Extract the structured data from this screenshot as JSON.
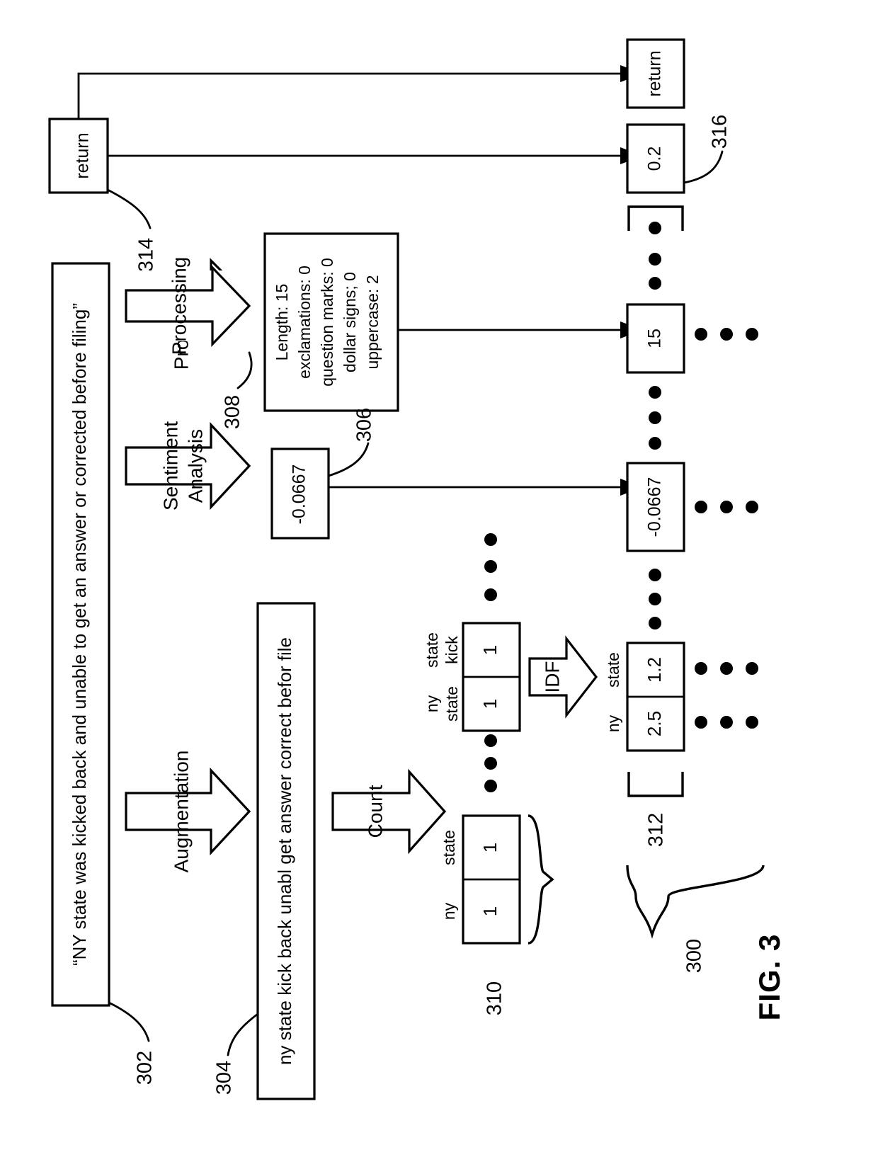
{
  "figure": {
    "label": "FIG. 3",
    "orientation": "landscape-rotated-90ccw"
  },
  "input": {
    "ref": "302",
    "text": "“NY state was kicked back and unable to get an answer or corrected before filing”"
  },
  "augmented": {
    "ref": "304",
    "text": "ny state kick back unabl get answer correct befor file"
  },
  "operations": {
    "processing": "Processing",
    "sentiment": "Sentiment\nAnalysis",
    "sentiment_line1": "Sentiment",
    "sentiment_line2": "Analysis",
    "augmentation": "Augmentation",
    "count": "Count",
    "idf": "IDF"
  },
  "processing_result": {
    "ref": "308",
    "lines": [
      "Length: 15",
      "exclamations: 0",
      "question marks: 0",
      "dollar signs; 0",
      "uppercase: 2"
    ]
  },
  "sentiment_result": {
    "ref": "306",
    "value": "-0.0667"
  },
  "unigram_counts": {
    "ref": "310",
    "headers": [
      "ny",
      "state"
    ],
    "values": [
      "1",
      "1"
    ]
  },
  "bigram_counts": {
    "headers_top": [
      "state",
      "kick"
    ],
    "headers_bottom": [
      "ny",
      "state"
    ],
    "values": [
      "1",
      "1"
    ]
  },
  "idf_result": {
    "ref": "312",
    "headers": [
      "ny",
      "state"
    ],
    "values": [
      "2.5",
      "1.2"
    ]
  },
  "feature_vector": {
    "ref": "300",
    "cells": [
      {
        "label": "return",
        "ref": ""
      },
      {
        "label": "0.2",
        "ref": "316"
      },
      {
        "label": "15",
        "ref": ""
      },
      {
        "label": "-0.0667",
        "ref": ""
      },
      {
        "label": "1.2",
        "ref": ""
      },
      {
        "label": "2.5",
        "ref": ""
      }
    ]
  },
  "return_source": {
    "ref": "314",
    "label": "return"
  },
  "ellipsis": {
    "glyph": "•",
    "count_per_group": 3
  },
  "colors": {
    "stroke": "#000000",
    "fill": "#ffffff",
    "background": "#ffffff"
  }
}
